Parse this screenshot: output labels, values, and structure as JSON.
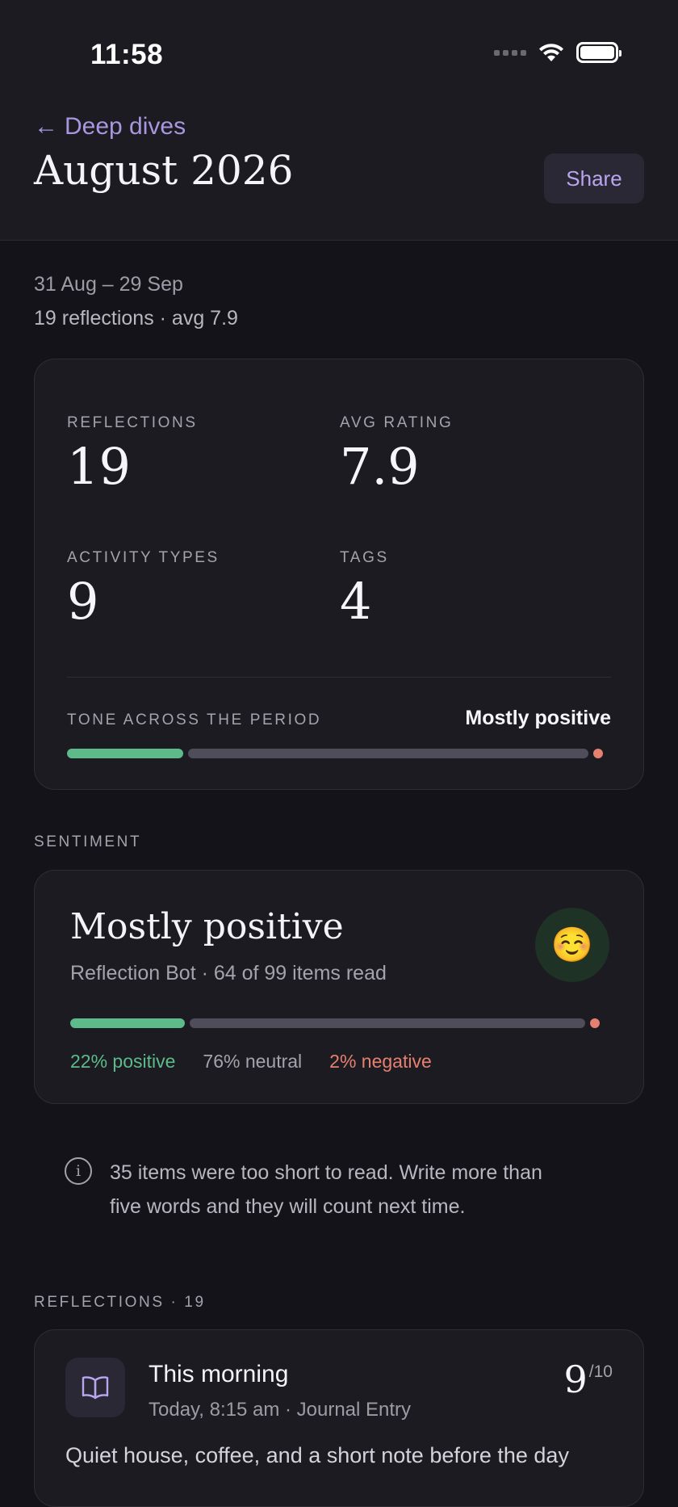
{
  "status_bar": {
    "time": "11:58"
  },
  "header": {
    "back_label": "Deep dives",
    "title": "August 2026",
    "share_label": "Share"
  },
  "period": {
    "range": "31 Aug – 29 Sep",
    "summary": "19 reflections · avg 7.9"
  },
  "stats": {
    "reflections_label": "REFLECTIONS",
    "reflections_value": "19",
    "avg_rating_label": "AVG RATING",
    "avg_rating_value": "7.9",
    "activity_types_label": "ACTIVITY TYPES",
    "activity_types_value": "9",
    "tags_label": "TAGS",
    "tags_value": "4",
    "tone_label": "TONE ACROSS THE PERIOD",
    "tone_value": "Mostly positive",
    "tone_bar": {
      "positive": 22,
      "neutral": 76,
      "negative": 2
    }
  },
  "sentiment": {
    "section_label": "SENTIMENT",
    "title": "Mostly positive",
    "subtitle": "Reflection Bot · 64 of 99 items read",
    "emoji": "☺️",
    "bar": {
      "positive": 22,
      "neutral": 76,
      "negative": 2
    },
    "positive_text": "22% positive",
    "neutral_text": "76% neutral",
    "negative_text": "2% negative"
  },
  "info": {
    "icon": "i",
    "line1": "35 items were too short to read. Write more than",
    "line2": "five words and they will count next time."
  },
  "reflections": {
    "section_label": "REFLECTIONS · 19",
    "items": [
      {
        "title": "This morning",
        "meta": "Today, 8:15 am · Journal Entry",
        "rating": "9",
        "rating_max": "/10",
        "text": "Quiet house, coffee, and a short note before the day"
      }
    ]
  }
}
